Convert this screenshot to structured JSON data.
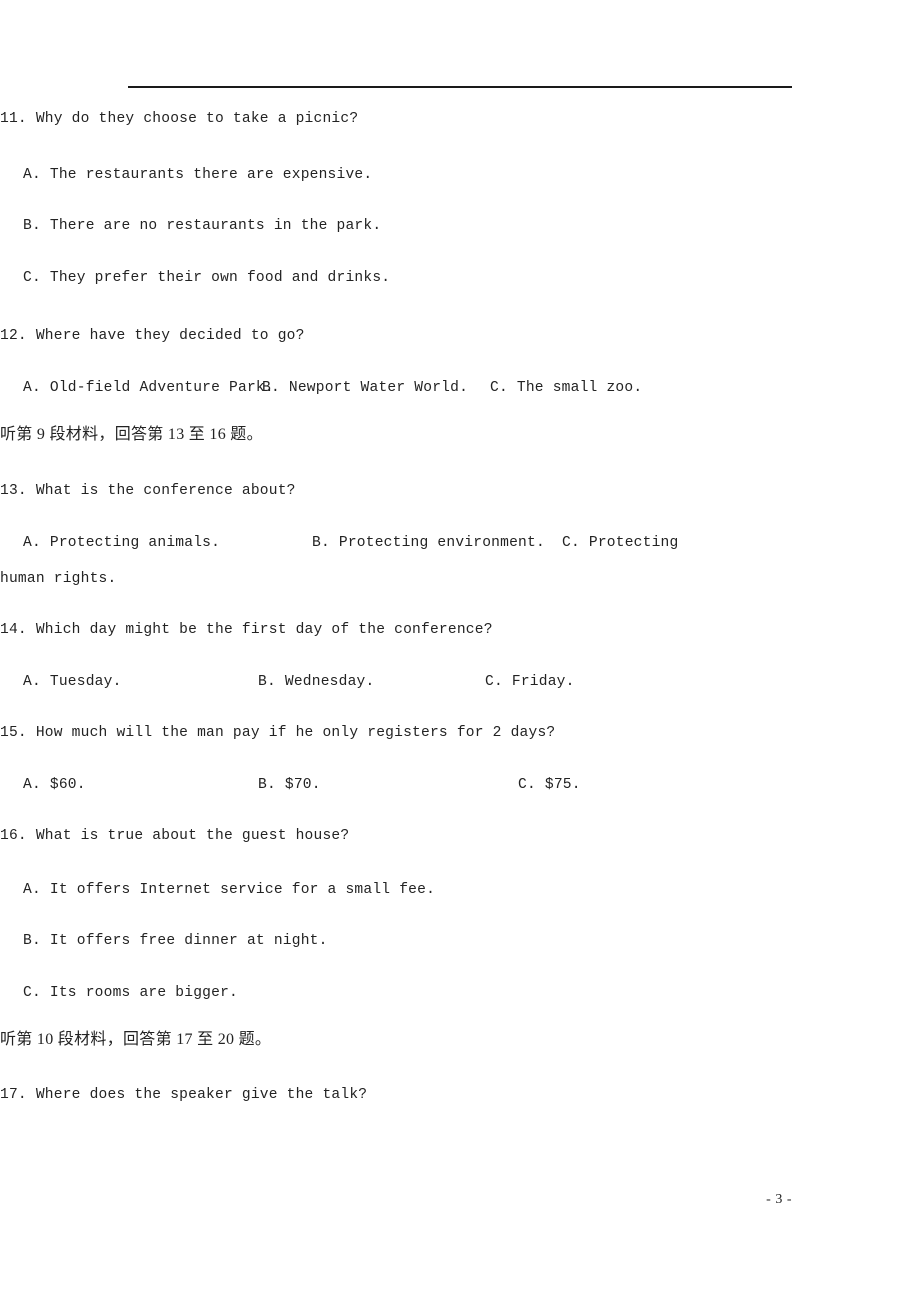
{
  "document": {
    "page_number_label": "- 3 -"
  },
  "questions": [
    {
      "number": "11.",
      "stem": "11. Why do they choose to take a picnic?",
      "layout": "stacked",
      "options": [
        "A. The restaurants there are expensive.",
        "B. There are no restaurants in the park.",
        "C. They prefer their own food and drinks."
      ]
    },
    {
      "number": "12.",
      "stem": "12. Where have they decided to go?",
      "layout": "inline",
      "options": [
        "A. Old-field Adventure Park.",
        "B. Newport Water World.",
        "C. The small zoo."
      ]
    },
    {
      "number": "13.",
      "stem": "13. What is the conference about?",
      "layout": "inline-wrap",
      "options": [
        "A. Protecting animals.",
        "B. Protecting environment.",
        "C. Protecting"
      ],
      "wrap_continuation": "human rights."
    },
    {
      "number": "14.",
      "stem": "14. Which day might be the first day of the conference?",
      "layout": "inline",
      "options": [
        "A. Tuesday.",
        "B. Wednesday.",
        "C. Friday."
      ]
    },
    {
      "number": "15.",
      "stem": "15. How much will the man pay if he only registers for 2 days?",
      "layout": "inline",
      "options": [
        "A. $60.",
        "B. $70.",
        "C. $75."
      ]
    },
    {
      "number": "16.",
      "stem": "16. What is true about the guest house?",
      "layout": "stacked",
      "options": [
        "A. It offers Internet service for a small fee.",
        "B. It offers free dinner at night.",
        "C. Its rooms are bigger."
      ]
    },
    {
      "number": "17.",
      "stem": "17. Where does the speaker give the talk?",
      "layout": "stem-only",
      "options": []
    }
  ],
  "section_instructions": [
    {
      "id": "material-9",
      "text": "听第 9 段材料，回答第 13 至 16 题。"
    },
    {
      "id": "material-10",
      "text": "听第 10 段材料，回答第 17 至 20 题。"
    }
  ]
}
